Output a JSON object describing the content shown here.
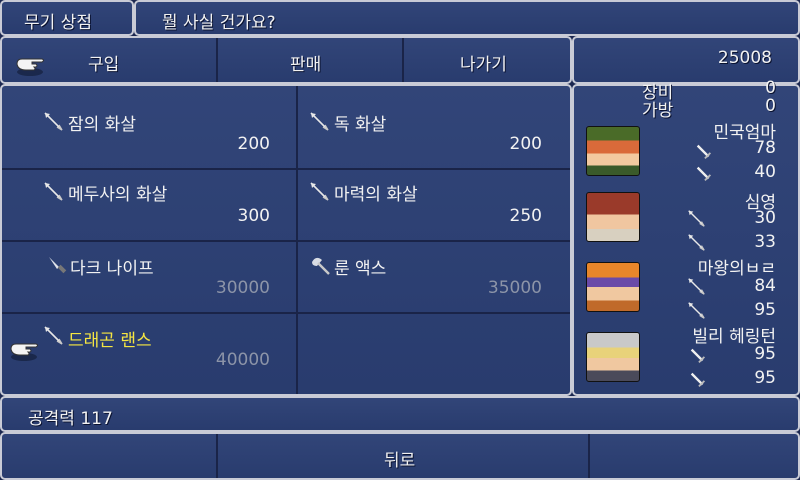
{
  "header": {
    "shop_title": "무기 상점",
    "prompt": "뭘 사실 건가요?"
  },
  "menu": {
    "buy": "구입",
    "sell": "판매",
    "exit": "나가기"
  },
  "gil": "25008",
  "items": [
    {
      "name": "잠의 화살",
      "price": "200",
      "icon": "arrow-icon",
      "affordable": true
    },
    {
      "name": "독 화살",
      "price": "200",
      "icon": "arrow-icon",
      "affordable": true
    },
    {
      "name": "메두사의 화살",
      "price": "300",
      "icon": "arrow-icon",
      "affordable": true
    },
    {
      "name": "마력의 화살",
      "price": "250",
      "icon": "arrow-icon",
      "affordable": true
    },
    {
      "name": "다크 나이프",
      "price": "30000",
      "icon": "knife-icon",
      "affordable": false
    },
    {
      "name": "룬 액스",
      "price": "35000",
      "icon": "axe-icon",
      "affordable": false
    },
    {
      "name": "드래곤 랜스",
      "price": "40000",
      "icon": "lance-icon",
      "affordable": false,
      "selected": true
    }
  ],
  "status": {
    "equip_label": "장비",
    "equip_value": "0",
    "bag_label": "가방",
    "bag_value": "0",
    "characters": [
      {
        "name": "민국엄마",
        "stat1": "78",
        "stat2": "40"
      },
      {
        "name": "심영",
        "stat1": "30",
        "stat2": "33"
      },
      {
        "name": "마왕의ㅂㄹ",
        "stat1": "84",
        "stat2": "95"
      },
      {
        "name": "빌리 헤링턴",
        "stat1": "95",
        "stat2": "95"
      }
    ]
  },
  "info": {
    "text": "공격력 117"
  },
  "footer": {
    "back": "뒤로"
  },
  "colors": {
    "panel": "#2b3f74",
    "border": "#c9cbd6",
    "highlight": "#f5e642",
    "dim": "#8c94a8"
  }
}
